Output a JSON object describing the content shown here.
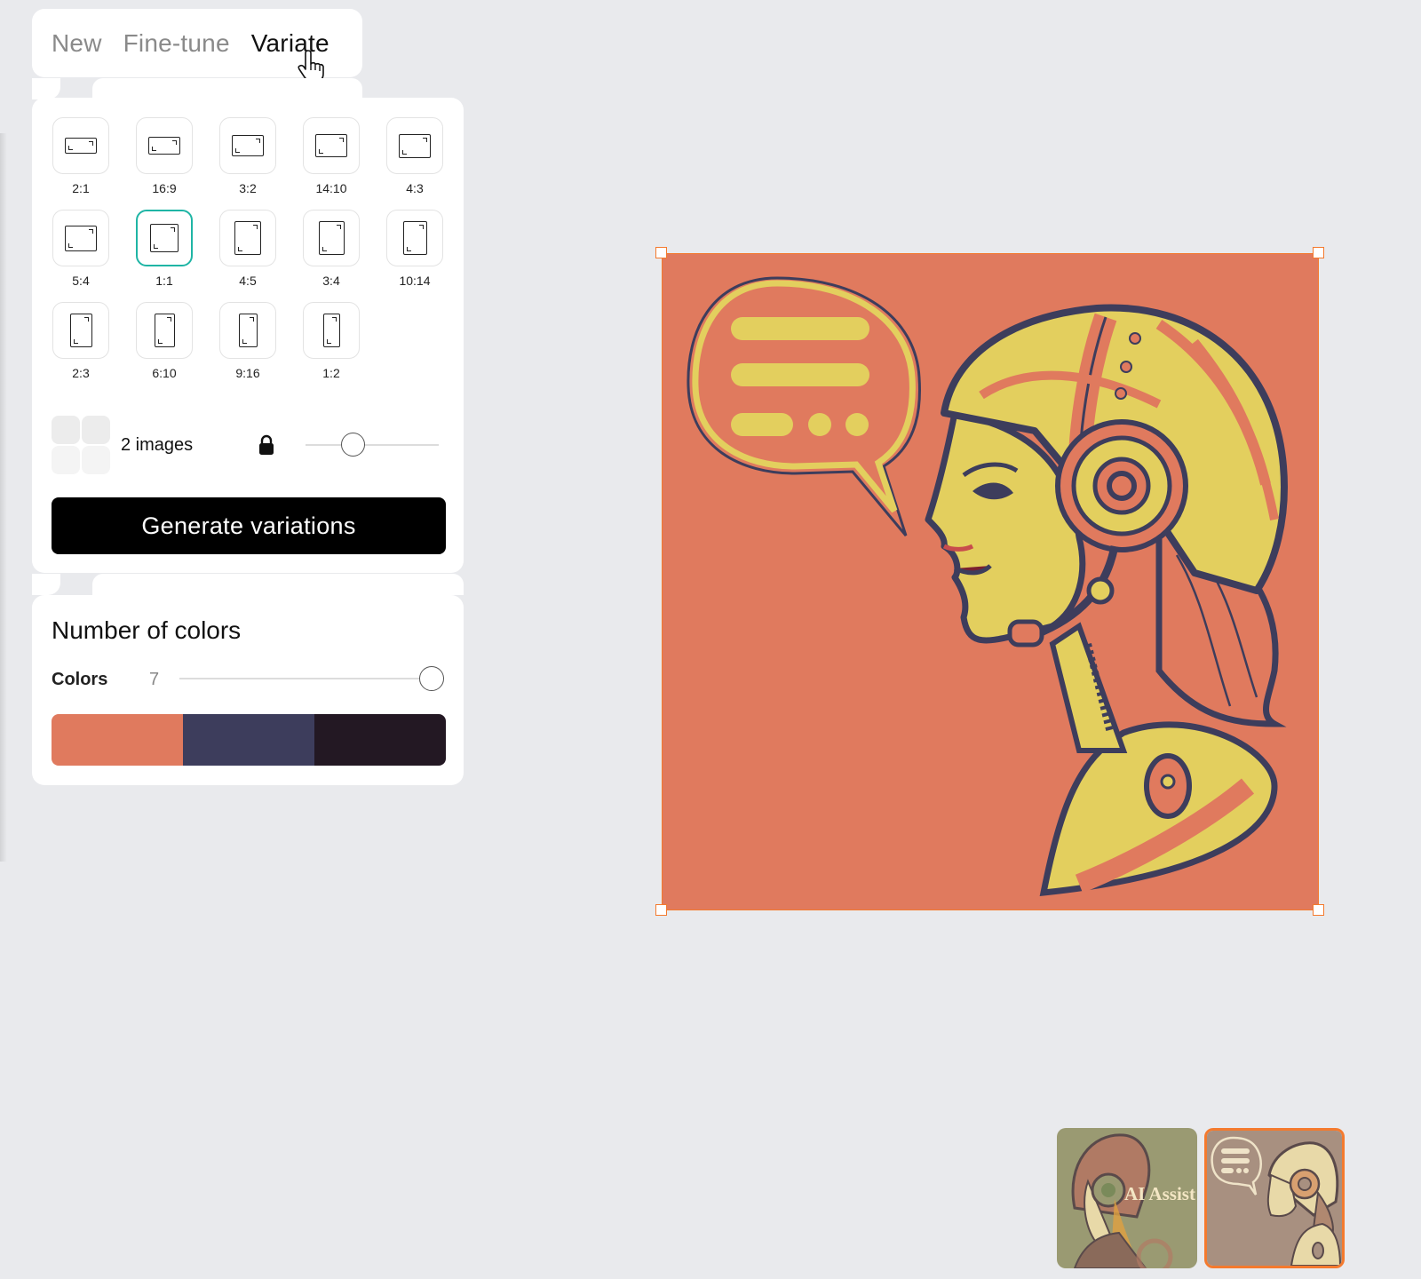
{
  "tabs": [
    {
      "label": "New",
      "active": false
    },
    {
      "label": "Fine-tune",
      "active": false
    },
    {
      "label": "Variate",
      "active": true
    }
  ],
  "aspect_ratios": [
    "2:1",
    "16:9",
    "3:2",
    "14:10",
    "4:3",
    "5:4",
    "1:1",
    "4:5",
    "3:4",
    "10:14",
    "2:3",
    "6:10",
    "9:16",
    "1:2"
  ],
  "selected_ratio": "1:1",
  "images": {
    "label": "2 images",
    "icon": "lock-icon"
  },
  "generate_button": {
    "label": "Generate variations"
  },
  "colors_panel": {
    "title": "Number of colors",
    "label": "Colors",
    "count": "7",
    "swatches": [
      "#e07a5e",
      "#3d3d5c",
      "#231823"
    ]
  },
  "canvas": {
    "selection_color": "#f47a2e",
    "background": "#e07a5e"
  },
  "thumbnails": [
    {
      "text": "AI Assist",
      "selected": false
    },
    {
      "text": "",
      "selected": true
    }
  ]
}
